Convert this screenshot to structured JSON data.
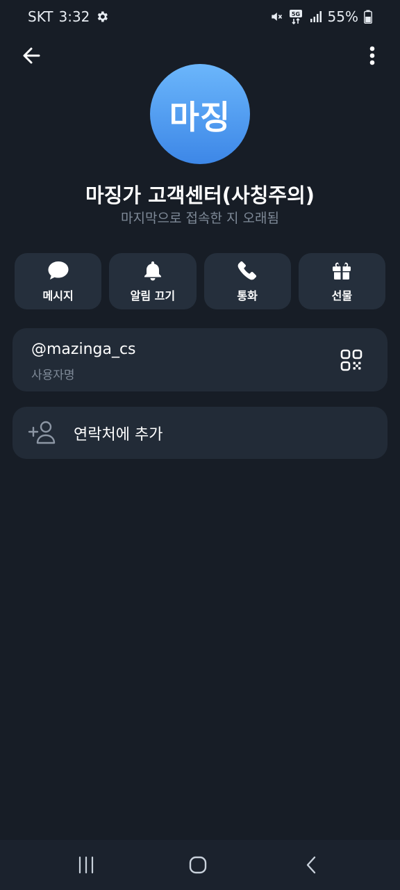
{
  "status_bar": {
    "carrier": "SKT",
    "time": "3:32",
    "network": "5G",
    "battery": "55%"
  },
  "profile": {
    "avatar_text": "마징",
    "name": "마징가 고객센터(사칭주의)",
    "last_seen": "마지막으로 접속한 지 오래됨"
  },
  "actions": [
    {
      "label": "메시지",
      "icon": "chat-bubble-icon"
    },
    {
      "label": "알림 끄기",
      "icon": "bell-icon"
    },
    {
      "label": "통화",
      "icon": "phone-icon"
    },
    {
      "label": "선물",
      "icon": "gift-icon"
    }
  ],
  "username": {
    "value": "@mazinga_cs",
    "label": "사용자명"
  },
  "add_contact": {
    "label": "연락처에 추가"
  },
  "colors": {
    "background": "#171d26",
    "card": "#222b37",
    "button": "#252f3c",
    "avatar_top": "#6bb6fb",
    "avatar_bottom": "#3d87e7",
    "muted_text": "#7f8a98"
  }
}
